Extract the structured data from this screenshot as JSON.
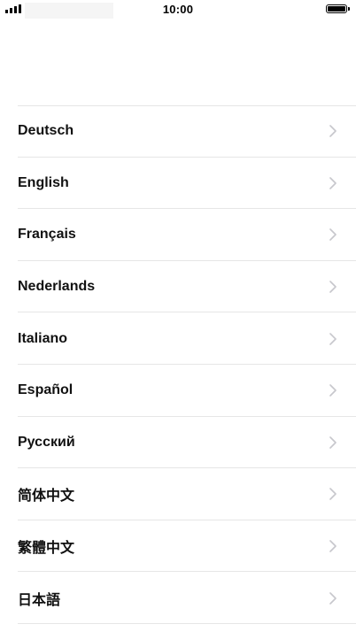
{
  "status_bar": {
    "time": "10:00",
    "signal_icon": "cellular-signal-icon",
    "battery_icon": "battery-full-icon",
    "battery_level": 1.0
  },
  "languages": [
    {
      "label": "Deutsch",
      "chevron_icon": "chevron-right-icon"
    },
    {
      "label": "English",
      "chevron_icon": "chevron-right-icon"
    },
    {
      "label": "Français",
      "chevron_icon": "chevron-right-icon"
    },
    {
      "label": "Nederlands",
      "chevron_icon": "chevron-right-icon"
    },
    {
      "label": "Italiano",
      "chevron_icon": "chevron-right-icon"
    },
    {
      "label": "Español",
      "chevron_icon": "chevron-right-icon"
    },
    {
      "label": "Русский",
      "chevron_icon": "chevron-right-icon"
    },
    {
      "label": "简体中文",
      "chevron_icon": "chevron-right-icon"
    },
    {
      "label": "繁體中文",
      "chevron_icon": "chevron-right-icon"
    },
    {
      "label": "日本語",
      "chevron_icon": "chevron-right-icon"
    }
  ],
  "colors": {
    "background": "#ffffff",
    "text": "#111111",
    "separator": "#e6e6e6",
    "chevron": "#c7c7cc"
  }
}
